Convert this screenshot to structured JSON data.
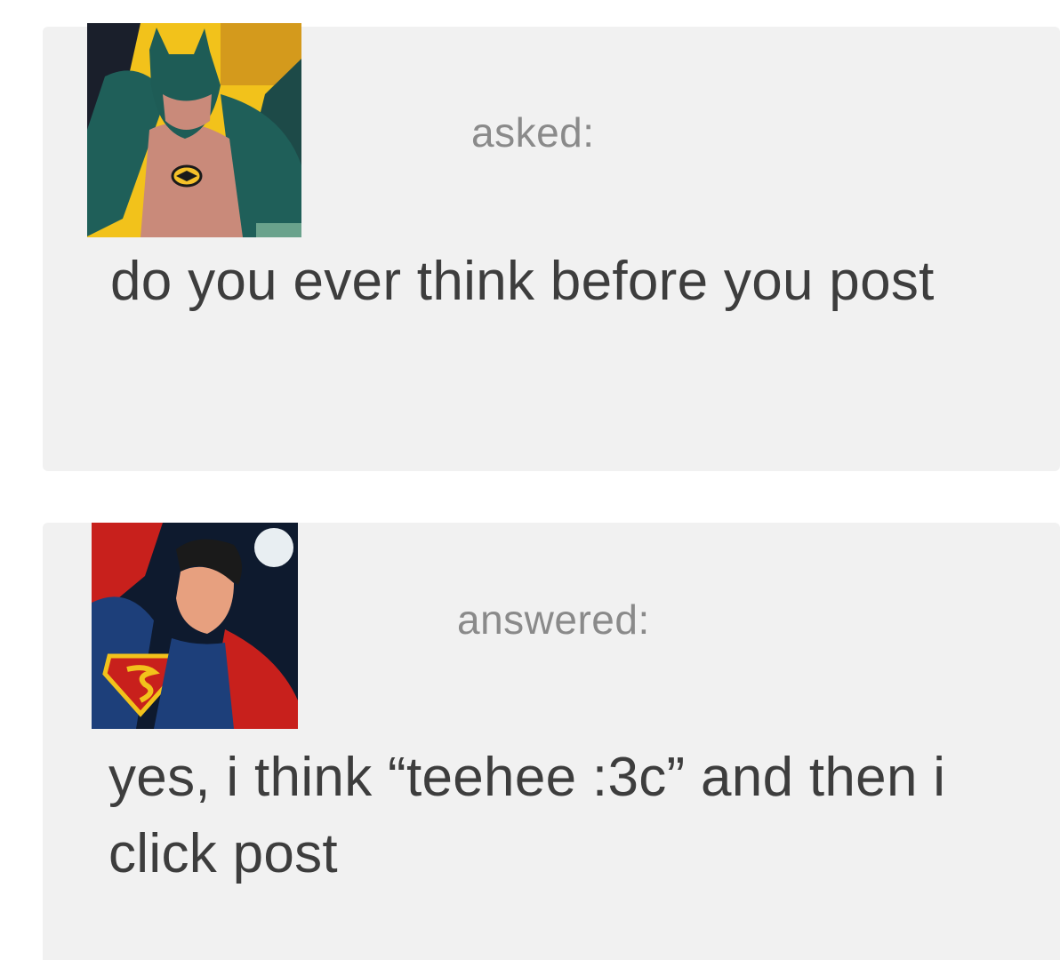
{
  "ask": {
    "avatar": "batman-avatar",
    "verb": "asked:",
    "message": "do you ever think before you post"
  },
  "answer": {
    "avatar": "superman-avatar",
    "verb": "answered:",
    "message": "yes, i think “teehee :3c” and then i click post"
  },
  "colors": {
    "card_bg": "#f1f1f1",
    "verb_text": "#8a8a8a",
    "message_text": "#3d3d3d"
  }
}
